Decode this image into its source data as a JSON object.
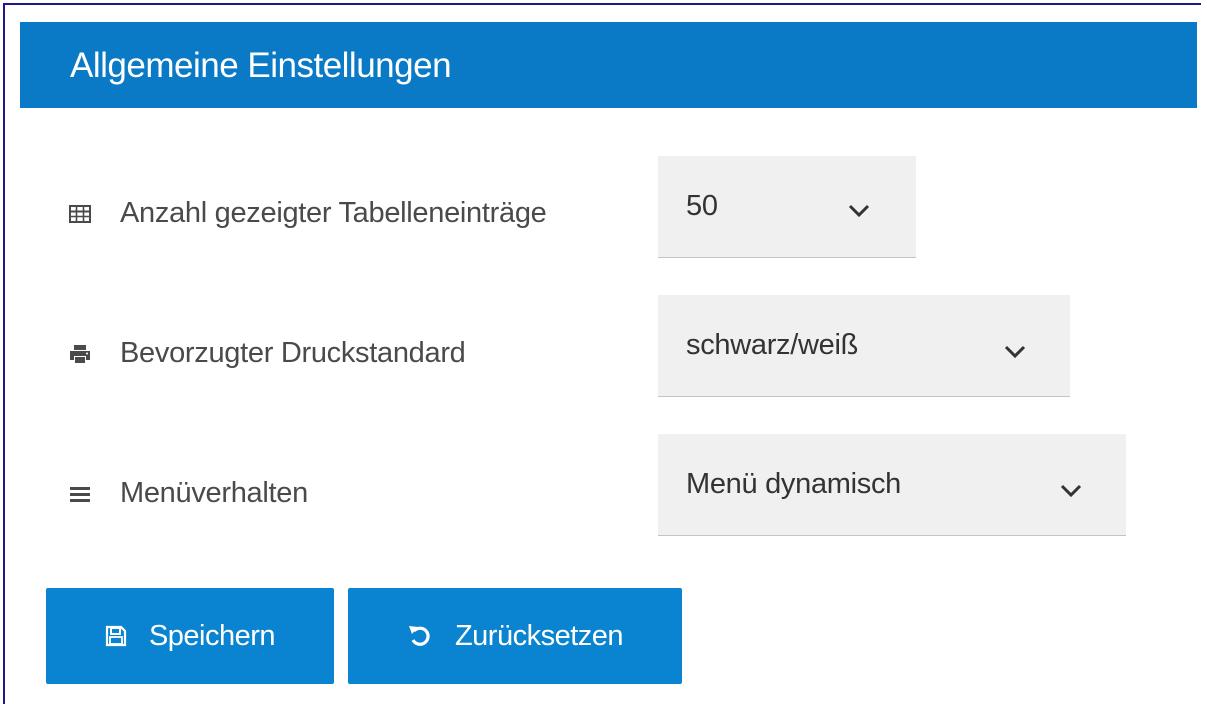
{
  "card": {
    "title": "Allgemeine Einstellungen",
    "header_color": "#0a7ac6"
  },
  "settings": [
    {
      "icon": "table-icon",
      "label": "Anzahl gezeigter Tabelleneinträge",
      "selected": "50"
    },
    {
      "icon": "printer-icon",
      "label": "Bevorzugter Druckstandard",
      "selected": "schwarz/weiß"
    },
    {
      "icon": "menu-icon",
      "label": "Menüverhalten",
      "selected": "Menü dynamisch"
    }
  ],
  "buttons": {
    "save": {
      "icon": "floppy-disk-icon",
      "label": "Speichern"
    },
    "reset": {
      "icon": "undo-icon",
      "label": "Zurücksetzen"
    }
  },
  "colors": {
    "accent": "#0a84d0",
    "text": "#4a4a4a",
    "select_bg": "#f0f0f0"
  }
}
